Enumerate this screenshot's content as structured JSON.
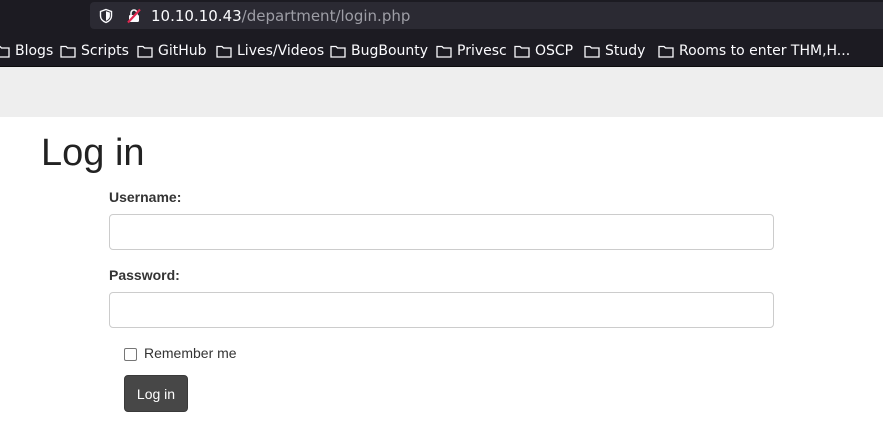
{
  "browser": {
    "url_host": "10.10.10.43",
    "url_path": "/department/login.php",
    "icons": [
      "shield-icon",
      "insecure-lock-icon"
    ],
    "bookmarks": [
      {
        "label": "Blogs"
      },
      {
        "label": "Scripts"
      },
      {
        "label": "GitHub"
      },
      {
        "label": "Lives/Videos"
      },
      {
        "label": "BugBounty"
      },
      {
        "label": "Privesc"
      },
      {
        "label": "OSCP"
      },
      {
        "label": "Study"
      },
      {
        "label": "Rooms to enter THM,H..."
      }
    ]
  },
  "page": {
    "title": "Log in",
    "username_label": "Username:",
    "username_value": "",
    "password_label": "Password:",
    "password_value": "",
    "remember_label": "Remember me",
    "remember_checked": false,
    "submit_label": "Log in"
  },
  "colors": {
    "chrome_bg": "#1c1b22",
    "navbar_bg": "#eeeeee",
    "button_bg": "#474747",
    "insecure_red": "#e22850"
  }
}
